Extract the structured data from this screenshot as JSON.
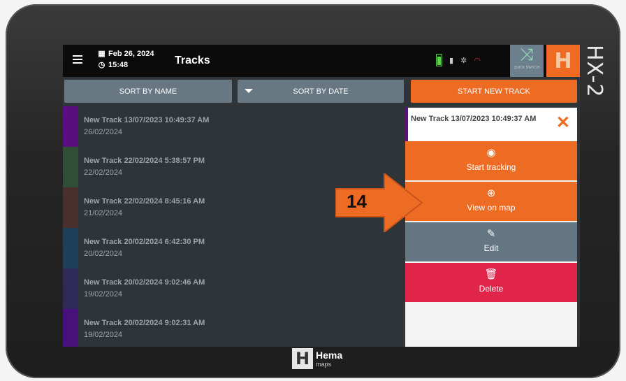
{
  "device": {
    "side_brand": "HX-2",
    "bottom_brand": "Hema",
    "bottom_brand_sub": "maps"
  },
  "topbar": {
    "date": "Feb 26, 2024",
    "time": "15:48",
    "title": "Tracks",
    "quick_switch_label": "QUICK SWITCH",
    "logo_letter": "H"
  },
  "sort": {
    "by_name": "SORT BY NAME",
    "by_date": "SORT BY DATE",
    "start_new": "START NEW TRACK"
  },
  "tracks": [
    {
      "name": "New Track 13/07/2023 10:49:37 AM",
      "date": "26/02/2024",
      "color": "#5a0f80"
    },
    {
      "name": "New Track 22/02/2024 5:38:57 PM",
      "date": "22/02/2024",
      "color": "#2f4e35"
    },
    {
      "name": "New Track 22/02/2024 8:45:16 AM",
      "date": "21/02/2024",
      "color": "#4a2f2f"
    },
    {
      "name": "New Track 20/02/2024 6:42:30 PM",
      "date": "20/02/2024",
      "color": "#1f3f58"
    },
    {
      "name": "New Track 20/02/2024 9:02:46 AM",
      "date": "19/02/2024",
      "color": "#2f2a5a"
    },
    {
      "name": "New Track 20/02/2024 9:02:31 AM",
      "date": "19/02/2024",
      "color": "#48107a"
    }
  ],
  "selected": {
    "name": "New Track 13/07/2023 10:49:37 AM",
    "actions": {
      "start_tracking": "Start tracking",
      "view_on_map": "View on map",
      "edit": "Edit",
      "delete": "Delete"
    }
  },
  "callout": {
    "number": "14"
  },
  "colors": {
    "accent": "#ee6b23",
    "gray": "#687883",
    "danger": "#e0244a"
  }
}
